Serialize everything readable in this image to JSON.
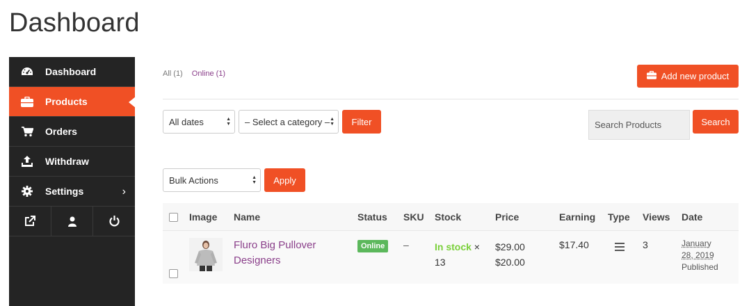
{
  "page": {
    "title": "Dashboard"
  },
  "sidebar": {
    "items": [
      {
        "label": "Dashboard",
        "icon": "dashboard-icon"
      },
      {
        "label": "Products",
        "icon": "briefcase-icon",
        "active": true
      },
      {
        "label": "Orders",
        "icon": "cart-icon"
      },
      {
        "label": "Withdraw",
        "icon": "upload-icon"
      },
      {
        "label": "Settings",
        "icon": "gear-icon",
        "chevron": "›"
      }
    ],
    "bottom_icons": [
      "external-link-icon",
      "user-icon",
      "power-icon"
    ]
  },
  "status_links": {
    "all": "All (1)",
    "online": "Online (1)"
  },
  "add_button": {
    "label": "Add new product"
  },
  "filters": {
    "dates": "All dates",
    "category": "– Select a category –",
    "filter_label": "Filter",
    "search_placeholder": "Search Products",
    "search_label": "Search"
  },
  "bulk": {
    "value": "Bulk Actions",
    "apply_label": "Apply"
  },
  "table": {
    "headers": [
      "Image",
      "Name",
      "Status",
      "SKU",
      "Stock",
      "Price",
      "Earning",
      "Type",
      "Views",
      "Date"
    ],
    "rows": [
      {
        "name_line1": "Fluro Big Pullover",
        "name_line2": "Designers",
        "status": "Online",
        "sku": "–",
        "stock_status": "In stock",
        "stock_suffix": "×",
        "stock_qty": "13",
        "price_regular": "$29.00",
        "price_sale": "$20.00",
        "earning": "$17.40",
        "type_icon": "menu-icon",
        "views": "3",
        "date_line1": "January",
        "date_line2": "28, 2019",
        "date_status": "Published"
      }
    ]
  },
  "colors": {
    "accent": "#f05025",
    "sidebar": "#242424",
    "link": "#8a3f8a",
    "instock": "#7ad03a",
    "badge": "#5cb85c"
  }
}
